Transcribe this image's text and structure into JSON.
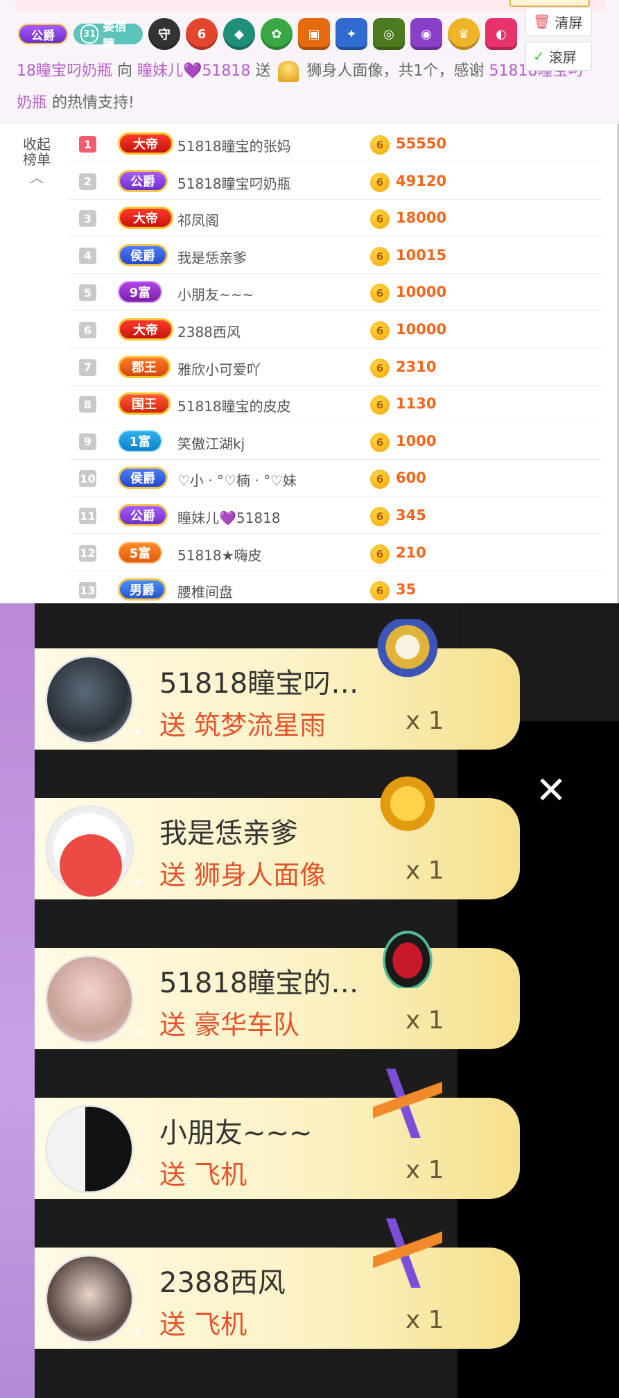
{
  "notice": {
    "badge_title": "公爵",
    "fan_level": "31",
    "fan_name": "晏宿瞳",
    "medal_icons": [
      "shield-medal-icon",
      "rank-6-medal-icon",
      "lantern-medal-icon",
      "flower-medal-icon",
      "lion-medal-icon",
      "star-medal-icon",
      "spiral-medal-icon",
      "helmet-medal-icon",
      "crown-medal-icon",
      "mouth-medal-icon"
    ],
    "medal_6_text": "6",
    "line_1_cut_suffix": "18",
    "line2_sender": "18瞳宝叼奶瓶",
    "line2_to": "向",
    "line2_receiver": "瞳妹儿",
    "line2_receiver_suffix": "51818",
    "line2_send": "送",
    "line2_gift": "狮身人面像，共1个，感谢",
    "line2_thanks_name": "51818瞳宝叼",
    "line3_name": "奶瓶",
    "line3_text": "的热情支持!",
    "clear_label": "清屏",
    "scroll_label": "滚屏"
  },
  "board": {
    "collapse_line1": "收起",
    "collapse_line2": "榜单",
    "rows": [
      {
        "rank": "1",
        "title": "大帝",
        "name": "51818瞳宝的张妈",
        "coin": "6",
        "score": "55550"
      },
      {
        "rank": "2",
        "title": "公爵",
        "name": "51818瞳宝叼奶瓶",
        "coin": "6",
        "score": "49120"
      },
      {
        "rank": "3",
        "title": "大帝",
        "name": "祁凤阁",
        "coin": "6",
        "score": "18000"
      },
      {
        "rank": "4",
        "title": "侯爵",
        "name": "我是恁亲爹",
        "coin": "6",
        "score": "10015"
      },
      {
        "rank": "5",
        "title": "9富",
        "name": "小朋友~~~",
        "coin": "6",
        "score": "10000"
      },
      {
        "rank": "6",
        "title": "大帝",
        "name": "2388西风",
        "coin": "6",
        "score": "10000"
      },
      {
        "rank": "7",
        "title": "郡王",
        "name": "雅欣小可爱吖",
        "coin": "6",
        "score": "2310"
      },
      {
        "rank": "8",
        "title": "国王",
        "name": "51818瞳宝的皮皮",
        "coin": "6",
        "score": "1130"
      },
      {
        "rank": "9",
        "title": "1富",
        "name": "笑傲江湖kj",
        "coin": "6",
        "score": "1000"
      },
      {
        "rank": "10",
        "title": "侯爵",
        "name": "♡小 · °♡楠 · °♡妹",
        "coin": "6",
        "score": "600"
      },
      {
        "rank": "11",
        "title": "公爵",
        "name": "瞳妹儿💜51818",
        "coin": "6",
        "score": "345"
      },
      {
        "rank": "12",
        "title": "5富",
        "name": "51818★嗨皮",
        "coin": "6",
        "score": "210"
      },
      {
        "rank": "13",
        "title": "男爵",
        "name": "腰椎间盘",
        "coin": "6",
        "score": "35"
      }
    ]
  },
  "gifts": [
    {
      "name": "51818瞳宝叼…",
      "send": "送 筑梦流星雨",
      "count": "x 1",
      "gift_icon": "astronaut-gift-icon"
    },
    {
      "name": "我是恁亲爹",
      "send": "送 狮身人面像",
      "count": "x 1",
      "gift_icon": "sphinx-gift-icon"
    },
    {
      "name": "51818瞳宝的…",
      "send": "送 豪华车队",
      "count": "x 1",
      "gift_icon": "sports-car-gift-icon"
    },
    {
      "name": "小朋友~~~",
      "send": "送 飞机",
      "count": "x 1",
      "gift_icon": "airplane-gift-icon"
    },
    {
      "name": "2388西风",
      "send": "送 飞机",
      "count": "x 1",
      "gift_icon": "airplane-gift-icon"
    }
  ],
  "close_symbol": "✕"
}
